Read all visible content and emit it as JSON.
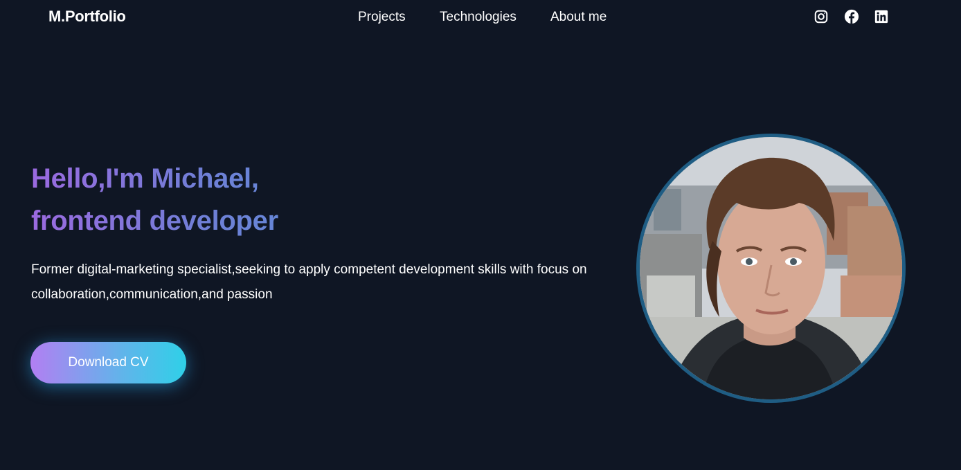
{
  "header": {
    "logo": "M.Portfolio",
    "nav": [
      {
        "label": "Projects"
      },
      {
        "label": "Technologies"
      },
      {
        "label": "About me"
      }
    ],
    "social": [
      {
        "icon": "instagram-icon"
      },
      {
        "icon": "facebook-icon"
      },
      {
        "icon": "linkedin-icon"
      }
    ]
  },
  "hero": {
    "title_line1": "Hello,I'm Michael,",
    "title_line2": "frontend developer",
    "description": "Former digital-marketing specialist,seeking to apply competent development skills with focus on collaboration,communication,and passion",
    "cta_label": "Download CV",
    "avatar_icon": "profile-photo"
  },
  "colors": {
    "background": "#0f1624",
    "title_gradient_start": "#9b6ae0",
    "title_gradient_end": "#5a8fd9",
    "button_gradient_start": "#b27ff2",
    "button_gradient_end": "#2fd0e8",
    "avatar_border": "#1f5d84"
  }
}
